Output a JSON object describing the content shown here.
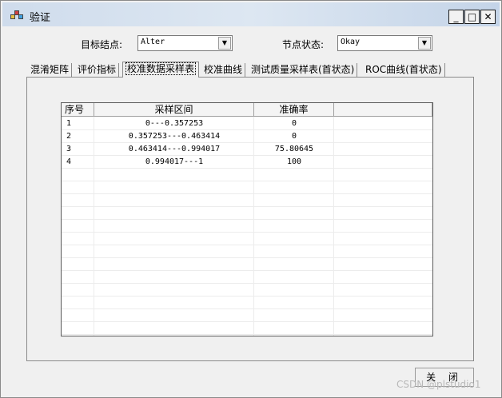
{
  "window": {
    "title": "验证",
    "min_label": "_",
    "max_label": "□",
    "close_label": "✕"
  },
  "filters": {
    "target_node_label": "目标结点:",
    "target_node_value": "Alter",
    "node_state_label": "节点状态:",
    "node_state_value": "Okay"
  },
  "tabs": [
    {
      "label": "混淆矩阵"
    },
    {
      "label": "评价指标"
    },
    {
      "label": "校准数据采样表"
    },
    {
      "label": "校准曲线"
    },
    {
      "label": "测试质量采样表(首状态)"
    },
    {
      "label": "ROC曲线(首状态)"
    }
  ],
  "active_tab": 2,
  "table": {
    "columns": [
      "序号",
      "采样区间",
      "准确率"
    ],
    "rows": [
      [
        "1",
        "0---0.357253",
        "0"
      ],
      [
        "2",
        "0.357253---0.463414",
        "0"
      ],
      [
        "3",
        "0.463414---0.994017",
        "75.80645"
      ],
      [
        "4",
        "0.994017---1",
        "100"
      ]
    ]
  },
  "footer": {
    "close_label": "关 闭"
  },
  "watermark": "CSDN @plstudio1"
}
